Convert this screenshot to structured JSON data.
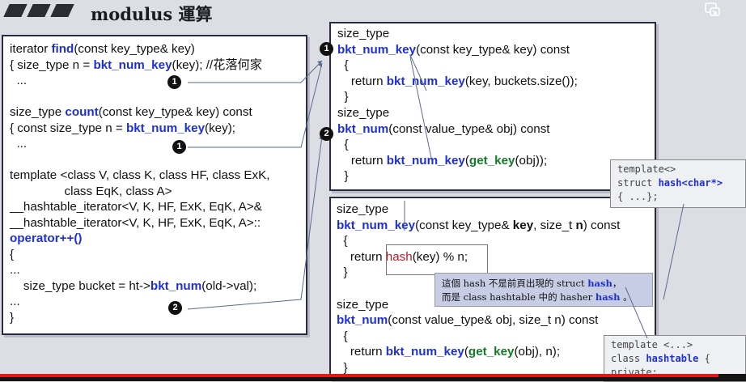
{
  "slide": {
    "title": "modulus 運算"
  },
  "left_panel": {
    "lines": [
      {
        "parts": [
          {
            "t": "iterator "
          },
          {
            "t": "find",
            "c": "k"
          },
          {
            "t": "(const key_type& key)"
          }
        ]
      },
      {
        "parts": [
          {
            "t": "{ size_type n = "
          },
          {
            "t": "bkt_num_key",
            "c": "k"
          },
          {
            "t": "(key); //花落何家"
          }
        ]
      },
      {
        "parts": [
          {
            "t": "  ..."
          }
        ]
      },
      {
        "parts": [
          {
            "t": ""
          }
        ]
      },
      {
        "parts": [
          {
            "t": "size_type "
          },
          {
            "t": "count",
            "c": "k"
          },
          {
            "t": "(const key_type& key) const"
          }
        ]
      },
      {
        "parts": [
          {
            "t": "{ const size_type n = "
          },
          {
            "t": "bkt_num_key",
            "c": "k"
          },
          {
            "t": "(key);"
          }
        ]
      },
      {
        "parts": [
          {
            "t": "  ..."
          }
        ]
      },
      {
        "parts": [
          {
            "t": ""
          }
        ]
      },
      {
        "parts": [
          {
            "t": "template <class V, class K, class HF, class ExK,"
          }
        ]
      },
      {
        "parts": [
          {
            "t": "                class EqK, class A>"
          }
        ]
      },
      {
        "parts": [
          {
            "t": "__hashtable_iterator<V, K, HF, ExK, EqK, A>&"
          }
        ]
      },
      {
        "parts": [
          {
            "t": "__hashtable_iterator<V, K, HF, ExK, EqK, A>::"
          }
        ]
      },
      {
        "parts": [
          {
            "t": "operator++()",
            "c": "op"
          }
        ]
      },
      {
        "parts": [
          {
            "t": "{"
          }
        ]
      },
      {
        "parts": [
          {
            "t": "..."
          }
        ]
      },
      {
        "parts": [
          {
            "t": "    size_type bucket = ht->"
          },
          {
            "t": "bkt_num",
            "c": "k"
          },
          {
            "t": "(old->val);"
          }
        ]
      },
      {
        "parts": [
          {
            "t": "..."
          }
        ]
      },
      {
        "parts": [
          {
            "t": "}"
          }
        ]
      }
    ],
    "markers": [
      "1",
      "1",
      "2"
    ]
  },
  "right_top_panel": {
    "lines": [
      {
        "parts": [
          {
            "t": "size_type"
          }
        ]
      },
      {
        "parts": [
          {
            "t": "bkt_num_key",
            "c": "k"
          },
          {
            "t": "(const key_type& key) const"
          }
        ]
      },
      {
        "parts": [
          {
            "t": "  {"
          }
        ]
      },
      {
        "parts": [
          {
            "t": "    return "
          },
          {
            "t": "bkt_num_key",
            "c": "k"
          },
          {
            "t": "(key, buckets.size());"
          }
        ]
      },
      {
        "parts": [
          {
            "t": "  }"
          }
        ]
      },
      {
        "parts": [
          {
            "t": "size_type"
          }
        ]
      },
      {
        "parts": [
          {
            "t": "bkt_num",
            "c": "k"
          },
          {
            "t": "(const value_type& obj) const"
          }
        ]
      },
      {
        "parts": [
          {
            "t": "  {"
          }
        ]
      },
      {
        "parts": [
          {
            "t": "    return "
          },
          {
            "t": "bkt_num_key",
            "c": "k"
          },
          {
            "t": "("
          },
          {
            "t": "get_key",
            "c": "g"
          },
          {
            "t": "(obj));"
          }
        ]
      },
      {
        "parts": [
          {
            "t": "  }"
          }
        ]
      }
    ],
    "markers": [
      "1",
      "2"
    ]
  },
  "right_bottom_panel": {
    "lines": [
      {
        "parts": [
          {
            "t": "size_type"
          }
        ]
      },
      {
        "parts": [
          {
            "t": "bkt_num_key",
            "c": "k"
          },
          {
            "t": "(const key_type& "
          },
          {
            "t": "key",
            "c": "b"
          },
          {
            "t": ", size_t "
          },
          {
            "t": "n",
            "c": "b"
          },
          {
            "t": ") const"
          }
        ]
      },
      {
        "parts": [
          {
            "t": "  {"
          }
        ]
      },
      {
        "parts": [
          {
            "t": "    return "
          },
          {
            "t": "hash",
            "c": "r"
          },
          {
            "t": "(key) % n;"
          }
        ]
      },
      {
        "parts": [
          {
            "t": "  }"
          }
        ]
      },
      {
        "parts": [
          {
            "t": ""
          }
        ]
      },
      {
        "parts": [
          {
            "t": "size_type"
          }
        ]
      },
      {
        "parts": [
          {
            "t": "bkt_num",
            "c": "k"
          },
          {
            "t": "(const value_type& obj, size_t n) const"
          }
        ]
      },
      {
        "parts": [
          {
            "t": "  {"
          }
        ]
      },
      {
        "parts": [
          {
            "t": "    return "
          },
          {
            "t": "bkt_num_key",
            "c": "k"
          },
          {
            "t": "("
          },
          {
            "t": "get_key",
            "c": "g"
          },
          {
            "t": "(obj), n);"
          }
        ]
      },
      {
        "parts": [
          {
            "t": "  }"
          }
        ]
      }
    ]
  },
  "note": {
    "line1_pre": "這個 hash 不是前頁出現的 struct ",
    "line1_kw": "hash",
    "line1_post": "，",
    "line2_pre": "而是 class hashtable 中的 hasher ",
    "line2_kw": "hash",
    "line2_post": " 。"
  },
  "template_hash_box": {
    "line1": "template<>",
    "line2_pre": "struct ",
    "line2_kw": "hash<char*>",
    "line3": "{ ...};"
  },
  "template_hashtable_box": {
    "line1": "template <...>",
    "line2_pre": "class ",
    "line2_kw": "hashtable",
    "line2_post": " {",
    "line3": "private:"
  },
  "colors": {
    "keyword": "#1e2fd8",
    "get_key": "#137a2a",
    "hash": "#c0182a",
    "progress": "#e01818"
  },
  "icons": {
    "corner": "picture-in-picture-icon"
  }
}
